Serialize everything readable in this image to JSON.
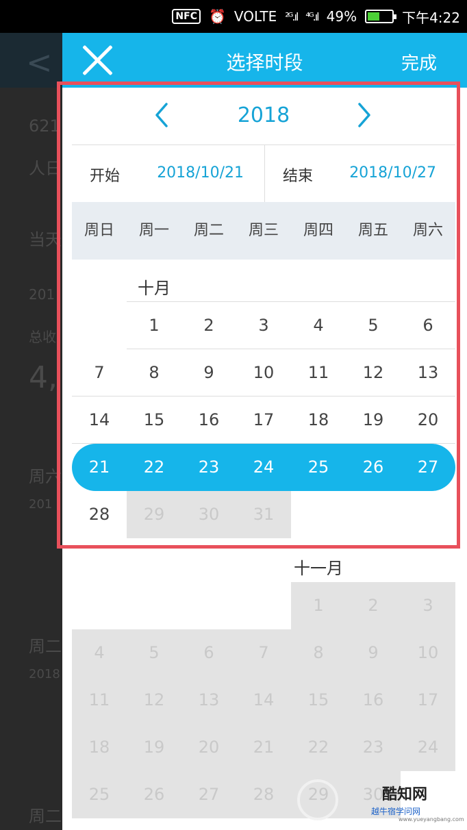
{
  "status_bar": {
    "nfc": "NFC",
    "alarm_icon": "alarm-clock-icon",
    "network": "VOLTE",
    "signal1": "²ᴳ.ıl",
    "signal2": "⁴ᴳ.ıl",
    "battery": "49%",
    "battery_level": 0.49,
    "time": "下午4:22"
  },
  "background_page": {
    "back_icon": "back-chevron-icon",
    "lines": [
      "621",
      "人日",
      "当天",
      "201",
      "总收",
      "4,",
      "周六",
      "201",
      "周二",
      "2018",
      "周二"
    ]
  },
  "header": {
    "close_icon": "close-icon",
    "title": "选择时段",
    "done_label": "完成",
    "bg_color": "#16b5ea"
  },
  "year_selector": {
    "year": "2018",
    "prev_icon": "chevron-left-icon",
    "next_icon": "chevron-right-icon"
  },
  "range": {
    "start_label": "开始",
    "start_value": "2018/10/21",
    "end_label": "结束",
    "end_value": "2018/10/27"
  },
  "weekdays": [
    "周日",
    "周一",
    "周二",
    "周三",
    "周四",
    "周五",
    "周六"
  ],
  "months": [
    {
      "label": "十月",
      "weeks": [
        [
          null,
          "1",
          "2",
          "3",
          "4",
          "5",
          "6"
        ],
        [
          "7",
          "8",
          "9",
          "10",
          "11",
          "12",
          "13"
        ],
        [
          "14",
          "15",
          "16",
          "17",
          "18",
          "19",
          "20"
        ],
        [
          "21",
          "22",
          "23",
          "24",
          "25",
          "26",
          "27"
        ],
        [
          "28",
          "29",
          "30",
          "31",
          null,
          null,
          null
        ]
      ],
      "selected_week": 3,
      "disabled_days": [
        "29",
        "30",
        "31"
      ]
    },
    {
      "label": "十一月",
      "weeks": [
        [
          null,
          null,
          null,
          null,
          "1",
          "2",
          "3"
        ],
        [
          "4",
          "5",
          "6",
          "7",
          "8",
          "9",
          "10"
        ],
        [
          "11",
          "12",
          "13",
          "14",
          "15",
          "16",
          "17"
        ],
        [
          "18",
          "19",
          "20",
          "21",
          "22",
          "23",
          "24"
        ],
        [
          "25",
          "26",
          "27",
          "28",
          "29",
          "30",
          null
        ]
      ],
      "all_disabled": true
    }
  ],
  "watermark": {
    "text": "酷知网",
    "sub": "越牛宿学问网",
    "url": "www.yueyangbang.com"
  },
  "colors": {
    "accent": "#16b5ea",
    "highlight_border": "#e8505b",
    "disabled_bg": "#e3e3e3"
  }
}
